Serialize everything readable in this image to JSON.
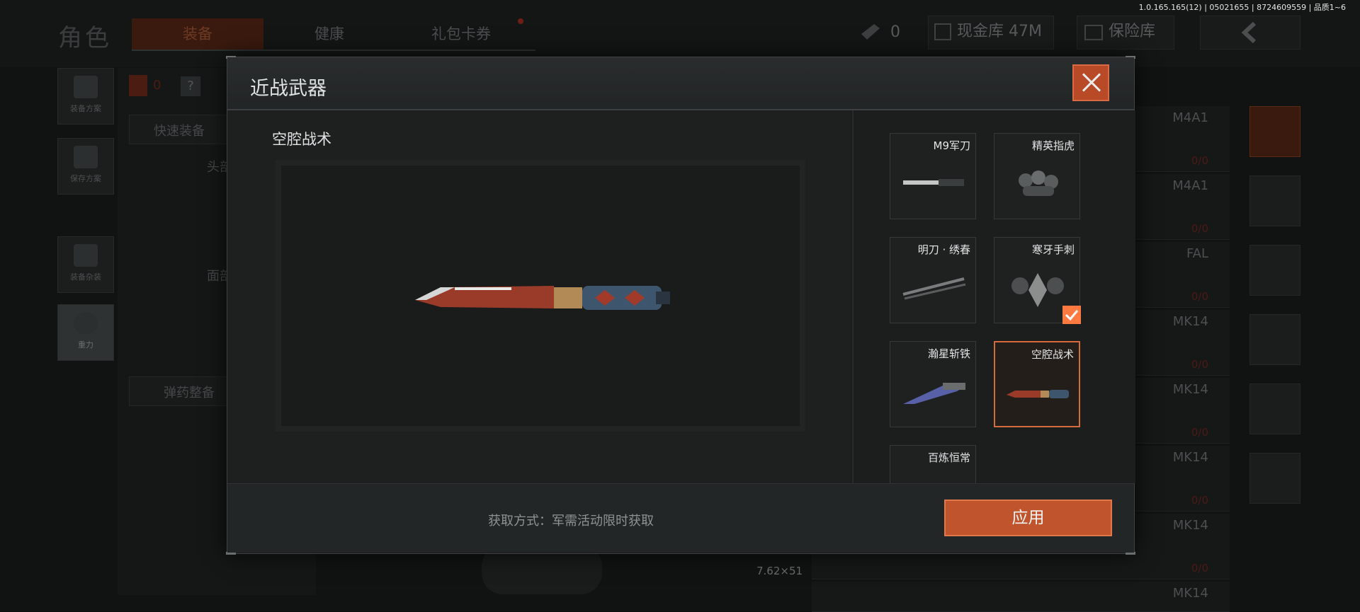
{
  "version": "1.0.165.165(12) | 05021655 | 8724609559 | 品质1~6",
  "background": {
    "title": "角色",
    "tabs": [
      {
        "label": "装备",
        "active": true
      },
      {
        "label": "健康",
        "active": false
      },
      {
        "label": "礼包卡券",
        "active": false
      }
    ],
    "stat_count": "0",
    "cash_vault": "现金库 47M",
    "insurance_vault": "保险库",
    "side_buttons": [
      "装备方案",
      "保存方案",
      "装备杂装",
      "重力"
    ],
    "helmet_count": "0",
    "help_glyph": "?",
    "quick_equip": "快速装备",
    "slot_head": "头部",
    "slot_face": "面部",
    "ammo_equip": "弹药整备",
    "ammo_caliber": "7.62×51",
    "weapon_rows": [
      {
        "gun": "M4A1",
        "ammo": "0/0"
      },
      {
        "gun": "M4A1",
        "ammo": "0/0"
      },
      {
        "gun": "FAL",
        "ammo": "0/0"
      },
      {
        "gun": "MK14",
        "ammo": "0/0"
      },
      {
        "gun": "MK14",
        "ammo": "0/0"
      },
      {
        "gun": "MK14",
        "ammo": "0/0"
      },
      {
        "gun": "MK14",
        "ammo": "0/0"
      },
      {
        "gun": "MK14",
        "ammo": ""
      }
    ]
  },
  "modal": {
    "title": "近战武器",
    "selected_name": "空腔战术",
    "source_text": "获取方式：军需活动限时获取",
    "apply_label": "应用",
    "items": [
      {
        "label": "M9军刀",
        "selected": false,
        "equipped": false
      },
      {
        "label": "精英指虎",
        "selected": false,
        "equipped": false
      },
      {
        "label": "明刀 · 绣春",
        "selected": false,
        "equipped": false
      },
      {
        "label": "寒牙手刺",
        "selected": false,
        "equipped": true
      },
      {
        "label": "瀚星斩铁",
        "selected": false,
        "equipped": false
      },
      {
        "label": "空腔战术",
        "selected": true,
        "equipped": false
      },
      {
        "label": "百炼恒常",
        "selected": false,
        "equipped": false
      }
    ]
  },
  "colors": {
    "accent": "#c0542d",
    "check": "#ff7a40",
    "panel": "#1b1d1d"
  }
}
